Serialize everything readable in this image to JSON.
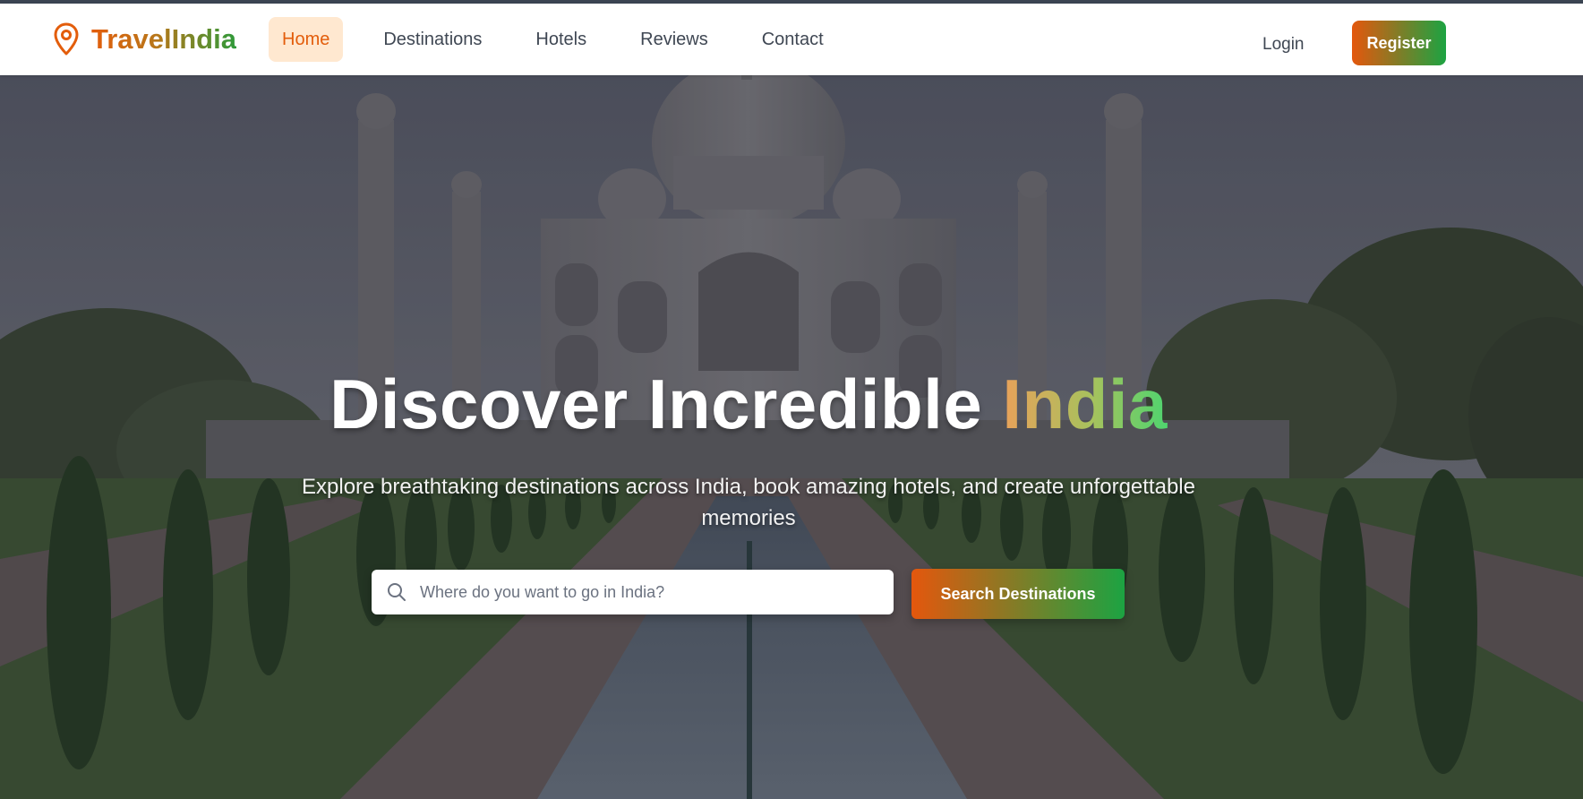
{
  "navbar": {
    "brand": "TravelIndia",
    "brand_icon": "map-pin-icon",
    "links": [
      "Home",
      "Destinations",
      "Hotels",
      "Reviews",
      "Contact"
    ],
    "active": "Home",
    "login_label": "Login",
    "register_label": "Register"
  },
  "hero": {
    "title_main": "Discover Incredible ",
    "title_accent": "India",
    "subtitle": "Explore breathtaking destinations across India, book amazing hotels, and create unforgettable memories",
    "search_placeholder": "Where do you want to go in India?",
    "search_button": "Search Destinations",
    "background": "Taj Mahal with reflecting pool and cypress trees"
  },
  "colors": {
    "orange": "#e35d0b",
    "green": "#1ca342",
    "active_bg": "#ffe8d0",
    "text": "#3f4753"
  }
}
